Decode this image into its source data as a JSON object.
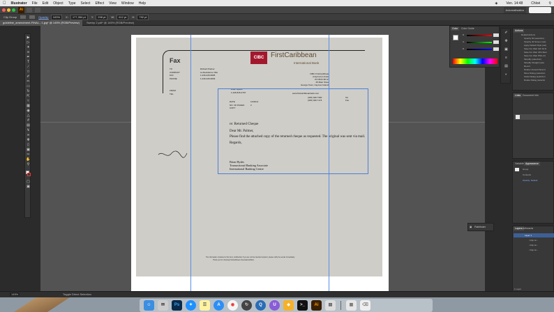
{
  "menubar": {
    "apple": "",
    "app_name": "Illustrator",
    "menus": [
      "File",
      "Edit",
      "Object",
      "Type",
      "Select",
      "Effect",
      "View",
      "Window",
      "Help"
    ],
    "datetime": "Ven. 14:48",
    "user": "Chloé"
  },
  "appbar": {
    "logo": "Ai",
    "workspace": "Automatisation"
  },
  "controlbar": {
    "selection_label": "Clip Group",
    "opacity_label": "Opacity:",
    "opacity_value": "100%",
    "x_value": "177,354 pt",
    "y_value": "298 pt",
    "w_value": "612 pt",
    "h_value": "792 pt"
  },
  "tabbar": {
    "active_tab": "guideline_amendment-FINAL...1.jpg* @ 145% (RGB/Preview)",
    "second_tab": "Sweep 2.pdf* @ 145% (RGB/Preview)"
  },
  "fax": {
    "title": "Fax",
    "labels": [
      "TO",
      "COMPANY",
      "FAX",
      "PHONE"
    ],
    "values": [
      "Richard Palmer",
      "La Residence Villa",
      "1-246-426-9605",
      "1-246-426-9603"
    ],
    "from_label": "FROM",
    "tel_label": "TEL",
    "from_value": "Brian Hydes",
    "tel_value": "1-345-815-2707",
    "brand": "FirstCaribbean",
    "brand_sub": "International Bank",
    "logo_text": "CIBC",
    "address": [
      "CIBC FirstCaribbean",
      "(Cayman) Limited",
      "PO BOX 68 GT",
      "25 Main Street",
      "George Town, Cayman Islands"
    ],
    "web": "www.firstcaribbeanbank.com",
    "phones": [
      "(345) 949 7300",
      "(345) 949 7174"
    ],
    "tel2": "Tel",
    "fax2": "Fax",
    "date_label": "DATE",
    "date_value": "11/02/11",
    "pages_label": "NO. OF PAGES",
    "pages_value": "2",
    "copy_label": "COPY",
    "re": "re: Returned Cheque",
    "dear": "Dear Mr. Palmer,",
    "body": "Please find the attached copy of the returned cheque as requested.  The original was sent via mail.",
    "regards": "Regards,",
    "sig_name": "Brian Hydes",
    "sig_title1": "Transactional Banking Associate",
    "sig_title2": "International Banking Centre",
    "footer1": "The information contained in this fax is confidential. If you are not the intended recipient, please notify the sender immediately.",
    "footer2": "Thank you for choosing FirstCaribbean International Bank."
  },
  "panels": {
    "color_tabs": [
      "Color",
      "Color Guide"
    ],
    "color_channels": [
      "R",
      "G",
      "B"
    ],
    "actions_tab": "Actions",
    "actions_items": [
      "Default Actions",
      "Opacity 60 (selection)",
      "Opacity 40 Screen (sel)",
      "Apply Default Style (sel)",
      "Save For Web GIF 64 D",
      "Save For Web JPG Med",
      "Save For Web PNG 24",
      "Simplify (selection)",
      "Simplify Straight (sele",
      "Revert",
      "Delete Unused Panel It",
      "Move Dialog (selection",
      "Scale Dialog (selection",
      "Rotate Dialog (selectio"
    ],
    "links_tabs": [
      "Links",
      "Document Info"
    ],
    "vars_tabs": [
      "Variables",
      "Appearance"
    ],
    "vars_items": [
      "Group",
      "Contents",
      "Opacity: Default"
    ],
    "pathfinder": "Pathfinder",
    "layers_tabs": [
      "Layers",
      "Artboards"
    ],
    "layers_items": [
      "Layer 1",
      "<Clip Gr...",
      "<Clip Gr...",
      "<Clip Gr..."
    ],
    "layers_count": "1 Layer"
  },
  "statusbar": {
    "zoom": "145%",
    "tool": "Toggle Direct Selection"
  },
  "dock": {
    "apps": [
      "Finder",
      "Mail",
      "Ps",
      "Safari",
      "Notes",
      "App Store",
      "Chrome",
      "Time Machine",
      "QuickTime",
      "Ugo",
      "Sketch",
      "Terminal",
      "Ai",
      "Preview",
      "Trash"
    ]
  }
}
